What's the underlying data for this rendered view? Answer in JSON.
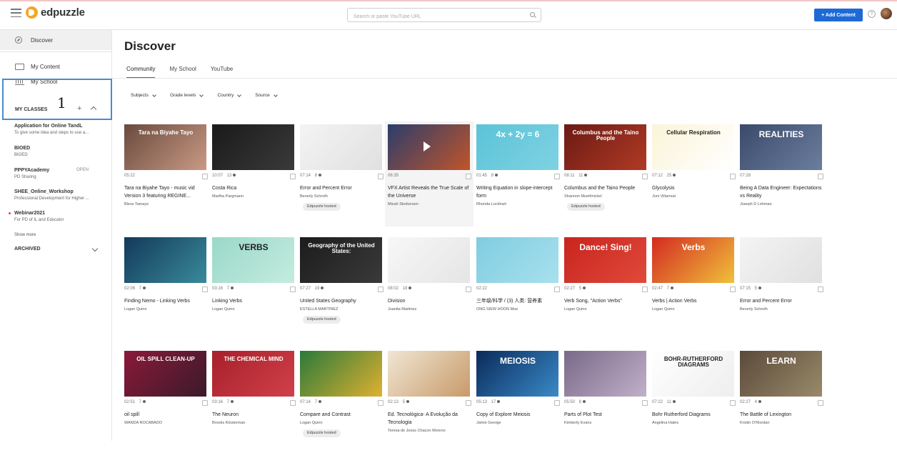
{
  "app": {
    "logo": "edpuzzle",
    "search_placeholder": "Search or paste YouTube URL",
    "add_content": "+ Add Content",
    "help": "?"
  },
  "sidebar": {
    "discover": "Discover",
    "my_content": "My Content",
    "my_school": "My School",
    "annotation": "1",
    "my_classes": "MY CLASSES",
    "plus": "+",
    "classes": [
      {
        "name": "Application for Online TandL",
        "sub": "To give some idea and steps to use a..."
      },
      {
        "name": "BIOED",
        "sub": "BIOED"
      },
      {
        "name": "PPPYAcademy",
        "sub": "PD Sharing",
        "badge": "OPEN"
      },
      {
        "name": "SHEE_Online_Workshop",
        "sub": "Professional Development for Higher ..."
      },
      {
        "name": "Webinar2021",
        "sub": "For PD of IL and Educator"
      }
    ],
    "show_more": "Show more",
    "archived": "ARCHIVED"
  },
  "main": {
    "title": "Discover",
    "tabs": [
      "Community",
      "My School",
      "YouTube"
    ],
    "filters": [
      "Subjects",
      "Grade levels",
      "Country",
      "Source"
    ],
    "hosted_label": "Edpuzzle hosted"
  },
  "videos": [
    {
      "duration": "05:22",
      "questions": "",
      "title": "Tara na Biyahe Tayo - music vid Version 3 featuring REGINE...",
      "author": "Bless Tamayo",
      "hosted": false,
      "thumb_text": "Tara na Biyahe Tayo",
      "colors": [
        "#6a4a3e",
        "#c99a85"
      ]
    },
    {
      "duration": "10:07",
      "questions": "13",
      "title": "Costa Rica",
      "author": "Martha Pargmann",
      "hosted": false,
      "thumb_text": "",
      "colors": [
        "#1a1a1a",
        "#3a3a3a"
      ]
    },
    {
      "duration": "07:14",
      "questions": "8",
      "title": "Error and Percent Error",
      "author": "Beverly Schroth",
      "hosted": true,
      "thumb_text": "",
      "colors": [
        "#f4f4f4",
        "#e0e0e0"
      ]
    },
    {
      "duration": "06:35",
      "questions": "",
      "title": "VFX Artist Reveals the True Scale of the Universe",
      "author": "Micah Storkersen",
      "hosted": false,
      "thumb_text": "",
      "colors": [
        "#2b3d6b",
        "#c0552a"
      ]
    },
    {
      "duration": "01:45",
      "questions": "8",
      "title": "Writing Equation in slope-intercept form",
      "author": "Rhonda Lockhart",
      "hosted": false,
      "thumb_text": "4x + 2y = 6",
      "colors": [
        "#5bc3d8",
        "#7fd2e2"
      ]
    },
    {
      "duration": "08:11",
      "questions": "11",
      "title": "Columbus and the Taino People",
      "author": "Shannon Muehlnickel",
      "hosted": true,
      "thumb_text": "Columbus and the Taino People",
      "colors": [
        "#6b1a14",
        "#b03a25"
      ]
    },
    {
      "duration": "07:12",
      "questions": "25",
      "title": "Glycolysis",
      "author": "Joni Villarreal",
      "hosted": false,
      "thumb_text": "Cellular Respiration",
      "colors": [
        "#fbf4d8",
        "#ffffff"
      ]
    },
    {
      "duration": "07:28",
      "questions": "",
      "title": "Being A Data Engineer: Expectations vs Reality",
      "author": "Joseph D Lehman",
      "hosted": false,
      "thumb_text": "REALITIES",
      "colors": [
        "#3a4a6a",
        "#6c7e9e"
      ]
    },
    {
      "duration": "02:06",
      "questions": "7",
      "title": "Finding Nemo - Linking Verbs",
      "author": "Logan Quinn",
      "hosted": false,
      "thumb_text": "",
      "colors": [
        "#123a5a",
        "#3a8a9a"
      ]
    },
    {
      "duration": "03:16",
      "questions": "7",
      "title": "Linking Verbs",
      "author": "Logan Quinn",
      "hosted": false,
      "thumb_text": "VERBS",
      "colors": [
        "#9ad8c8",
        "#c4ece0"
      ]
    },
    {
      "duration": "07:27",
      "questions": "19",
      "title": "United States Geography",
      "author": "ESTELLA MARTINEZ",
      "hosted": true,
      "thumb_text": "Geography of the United States:",
      "colors": [
        "#1c1c1c",
        "#3a3a3a"
      ]
    },
    {
      "duration": "08:02",
      "questions": "18",
      "title": "Division",
      "author": "Juanita Martinez",
      "hosted": false,
      "thumb_text": "",
      "colors": [
        "#f7f7f7",
        "#e5e5e5"
      ]
    },
    {
      "duration": "02:22",
      "questions": "",
      "title": "三年级/科学 / (3) 人类: 营养素",
      "author": "ONG SIEW HOON Moe",
      "hosted": false,
      "thumb_text": "",
      "colors": [
        "#7fcde0",
        "#a8e0ee"
      ]
    },
    {
      "duration": "02:27",
      "questions": "5",
      "title": "Verb Song, \"Action Verbs\"",
      "author": "Logan Quinn",
      "hosted": false,
      "thumb_text": "Dance! Sing!",
      "colors": [
        "#c8241e",
        "#e04a3a"
      ]
    },
    {
      "duration": "02:47",
      "questions": "7",
      "title": "Verbs | Action Verbs",
      "author": "Logan Quinn",
      "hosted": false,
      "thumb_text": "Verbs",
      "colors": [
        "#d32a22",
        "#f0c03a"
      ]
    },
    {
      "duration": "07:15",
      "questions": "5",
      "title": "Error and Percent Error",
      "author": "Beverly Schroth",
      "hosted": false,
      "thumb_text": "",
      "colors": [
        "#f4f4f4",
        "#e0e0e0"
      ]
    },
    {
      "duration": "02:51",
      "questions": "7",
      "title": "oil spill",
      "author": "WANDA ROCABADO",
      "hosted": false,
      "thumb_text": "OIL SPILL CLEAN-UP",
      "colors": [
        "#8a1a3a",
        "#3a1a2a"
      ]
    },
    {
      "duration": "03:16",
      "questions": "7",
      "title": "The Neuron",
      "author": "Brooks Klosterman",
      "hosted": false,
      "thumb_text": "THE CHEMICAL MIND",
      "colors": [
        "#a8202a",
        "#d0404a"
      ]
    },
    {
      "duration": "07:14",
      "questions": "7",
      "title": "Compare and Contrast",
      "author": "Logan Quinn",
      "hosted": true,
      "thumb_text": "",
      "colors": [
        "#2a7a3a",
        "#e0b030"
      ]
    },
    {
      "duration": "02:13",
      "questions": "5",
      "title": "Ed. Tecnológica- A Evolução da Tecnologia",
      "author": "Teresa de Jesús Chacon Moreno",
      "hosted": false,
      "thumb_text": "",
      "colors": [
        "#f0e6d4",
        "#c89a6a"
      ]
    },
    {
      "duration": "05:13",
      "questions": "17",
      "title": "Copy of Explore Meiosis",
      "author": "Jamie George",
      "hosted": false,
      "thumb_text": "MEIOSIS",
      "colors": [
        "#0a2a5a",
        "#3a8ac8"
      ]
    },
    {
      "duration": "05:50",
      "questions": "8",
      "title": "Parts of Plot Test",
      "author": "Kimberly Evans",
      "hosted": false,
      "thumb_text": "",
      "colors": [
        "#7a6a8a",
        "#c0b0c8"
      ]
    },
    {
      "duration": "07:22",
      "questions": "11",
      "title": "Bohr Rutherford Diagrams",
      "author": "Angelina Hales",
      "hosted": false,
      "thumb_text": "BOHR-RUTHERFORD DIAGRAMS",
      "colors": [
        "#ffffff",
        "#eeeeee"
      ]
    },
    {
      "duration": "02:27",
      "questions": "4",
      "title": "The Battle of Lexington",
      "author": "Kristin O'Riordan",
      "hosted": false,
      "thumb_text": "LEARN",
      "colors": [
        "#5a4a3a",
        "#9a8a6a"
      ]
    }
  ]
}
